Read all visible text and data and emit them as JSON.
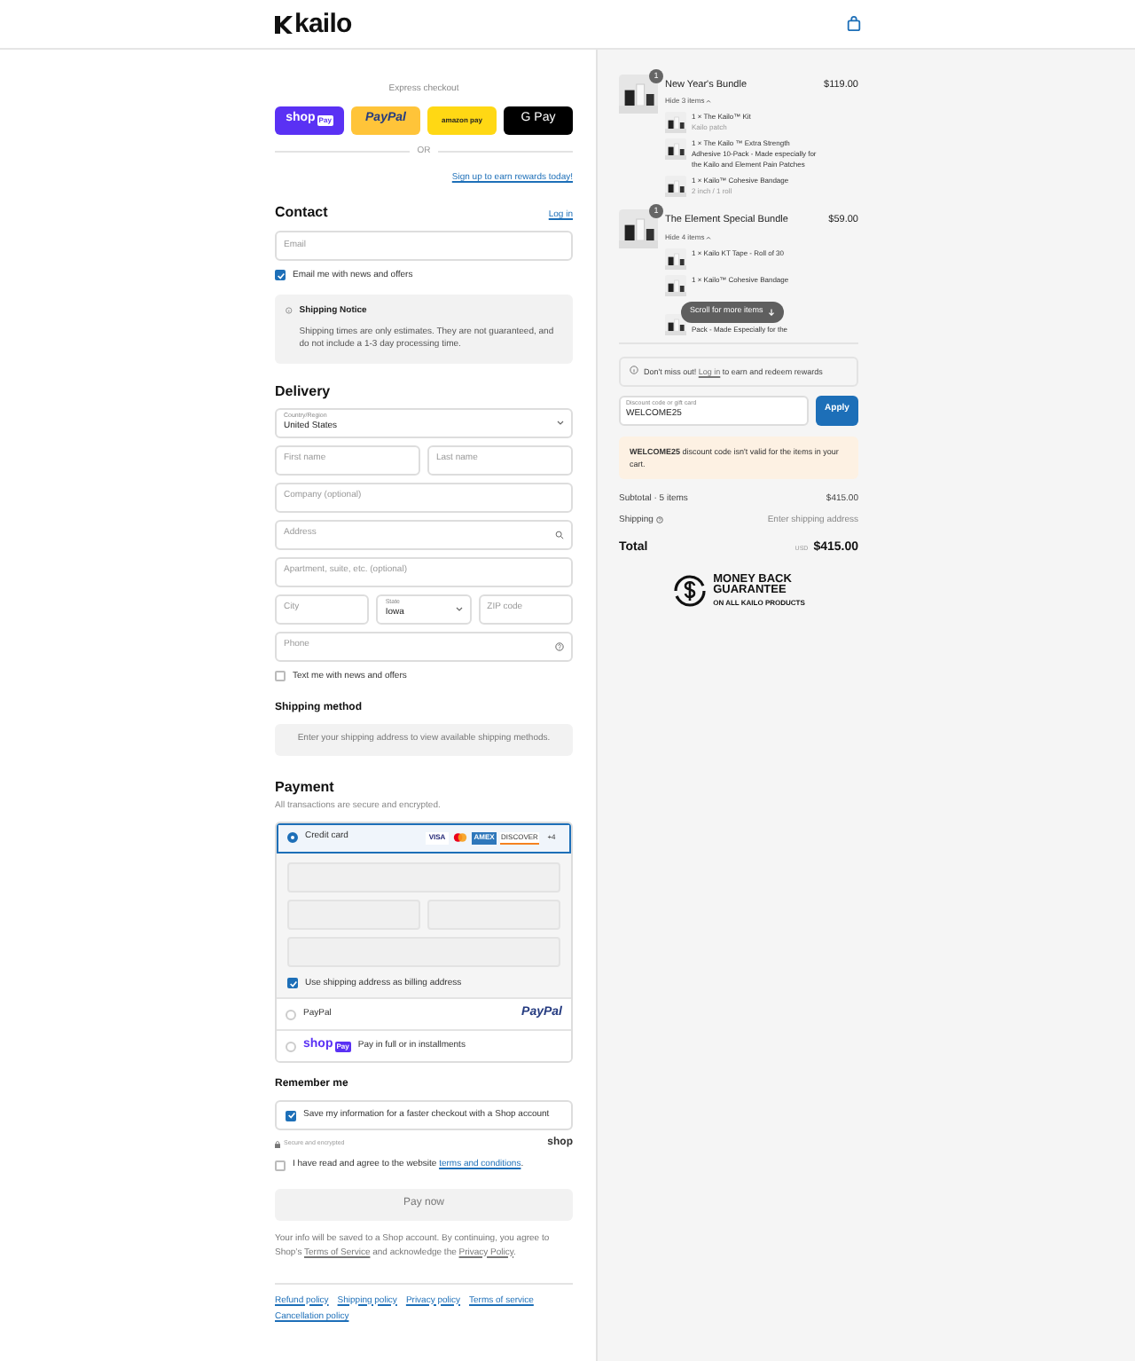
{
  "header": {
    "logo": "kailo"
  },
  "express": {
    "title": "Express checkout",
    "buttons": [
      {
        "kind": "shop",
        "label": "shop",
        "badge": "Pay"
      },
      {
        "kind": "paypal",
        "label": "PayPal"
      },
      {
        "kind": "amazon",
        "label": "amazon pay"
      },
      {
        "kind": "gpay",
        "label": "G Pay"
      }
    ],
    "separator": "OR",
    "rewards_link": "Sign up to earn rewards today!"
  },
  "contact": {
    "heading": "Contact",
    "login": "Log in",
    "email_placeholder": "Email",
    "newsletter": {
      "label": "Email me with news and offers",
      "checked": true
    },
    "notice": {
      "title": "Shipping Notice",
      "text": "Shipping times are only estimates. They are not guaranteed, and do not include a 1-3 day processing time."
    }
  },
  "delivery": {
    "heading": "Delivery",
    "rows": [
      [
        {
          "kind": "select",
          "label": "Country/Region",
          "value": "United States"
        }
      ],
      [
        {
          "kind": "text",
          "placeholder": "First name"
        },
        {
          "kind": "text",
          "placeholder": "Last name"
        }
      ],
      [
        {
          "kind": "text",
          "placeholder": "Company (optional)"
        }
      ],
      [
        {
          "kind": "search",
          "placeholder": "Address"
        }
      ],
      [
        {
          "kind": "text",
          "placeholder": "Apartment, suite, etc. (optional)"
        }
      ],
      [
        {
          "kind": "text",
          "placeholder": "City"
        },
        {
          "kind": "select",
          "label": "State",
          "value": "Iowa"
        },
        {
          "kind": "text",
          "placeholder": "ZIP code"
        }
      ],
      [
        {
          "kind": "help",
          "placeholder": "Phone"
        }
      ]
    ],
    "sms": {
      "label": "Text me with news and offers",
      "checked": false
    }
  },
  "shipping_method": {
    "heading": "Shipping method",
    "message": "Enter your shipping address to view available shipping methods."
  },
  "payment": {
    "heading": "Payment",
    "subtitle": "All transactions are secure and encrypted.",
    "methods": [
      {
        "kind": "card",
        "label": "Credit card",
        "selected": true,
        "brands": [
          {
            "kind": "visa",
            "text": "VISA"
          },
          {
            "kind": "mastercard"
          },
          {
            "kind": "amex",
            "text": "AMEX"
          },
          {
            "kind": "discover",
            "text": "DISCOVER"
          },
          {
            "kind": "more",
            "text": "+4"
          }
        ],
        "billing": {
          "label": "Use shipping address as billing address",
          "checked": true
        }
      },
      {
        "kind": "paypal",
        "label": "PayPal",
        "selected": false,
        "logo": "PayPal"
      },
      {
        "kind": "shoppay",
        "label": "Pay in full or in installments",
        "selected": false,
        "logo": "shop",
        "badge": "Pay"
      }
    ]
  },
  "remember": {
    "heading": "Remember me",
    "save": {
      "label": "Save my information for a faster checkout with a Shop account",
      "checked": true
    },
    "secure": "Secure and encrypted",
    "shop": "shop"
  },
  "terms": {
    "text": "I have read and agree to the website ",
    "link": "terms and conditions",
    "end": ".",
    "checked": false
  },
  "pay_button": "Pay now",
  "disclaimer": [
    {
      "text": "Your info will be saved to a Shop account. By continuing, you agree to Shop’s "
    },
    {
      "link": "Terms of Service"
    },
    {
      "text": " and acknowledge the "
    },
    {
      "link": "Privacy Policy"
    },
    {
      "text": "."
    }
  ],
  "policies": [
    "Refund policy",
    "Shipping policy",
    "Privacy policy",
    "Terms of service",
    "Cancellation policy"
  ],
  "cart": {
    "items": [
      {
        "title": "New Year's Bundle",
        "price": "$119.00",
        "quantity": "1",
        "toggle": "Hide 3 items",
        "children": [
          {
            "text": "1 × The Kailo™ Kit",
            "sub": "Kailo patch"
          },
          {
            "text": "1 × The Kailo ™ Extra Strength Adhesive 10-Pack - Made especially for the Kailo and Element Pain Patches"
          },
          {
            "text": "1 × Kailo™ Cohesive Bandage",
            "sub": "2 inch / 1 roll"
          }
        ]
      },
      {
        "title": "The Element Special Bundle",
        "price": "$59.00",
        "quantity": "1",
        "toggle": "Hide 4 items",
        "children": [
          {
            "text": "1 × Kailo KT Tape - Roll of 30"
          },
          {
            "text": "1 × Kailo™ Cohesive Bandage"
          },
          {
            "text": "Pack - Made Especially for the"
          }
        ]
      }
    ],
    "scroll_hint": "Scroll for more items"
  },
  "rewards": [
    {
      "text": "Don't miss out! "
    },
    {
      "link": "Log in"
    },
    {
      "text": " to earn and redeem rewards"
    }
  ],
  "discount": {
    "label": "Discount code or gift card",
    "value": "WELCOME25",
    "button": "Apply"
  },
  "warning": "**WELCOME25** discount code isn't valid for the items in your cart.",
  "summary": {
    "subtotal_label": "Subtotal · 5 items",
    "subtotal": "$415.00",
    "shipping_label": "Shipping",
    "shipping": "Enter shipping address",
    "total_label": "Total",
    "currency": "USD",
    "total": "$415.00"
  },
  "guarantee": {
    "line1": "MONEY BACK",
    "line2": "GUARANTEE",
    "line3": "ON ALL KAILO PRODUCTS"
  }
}
